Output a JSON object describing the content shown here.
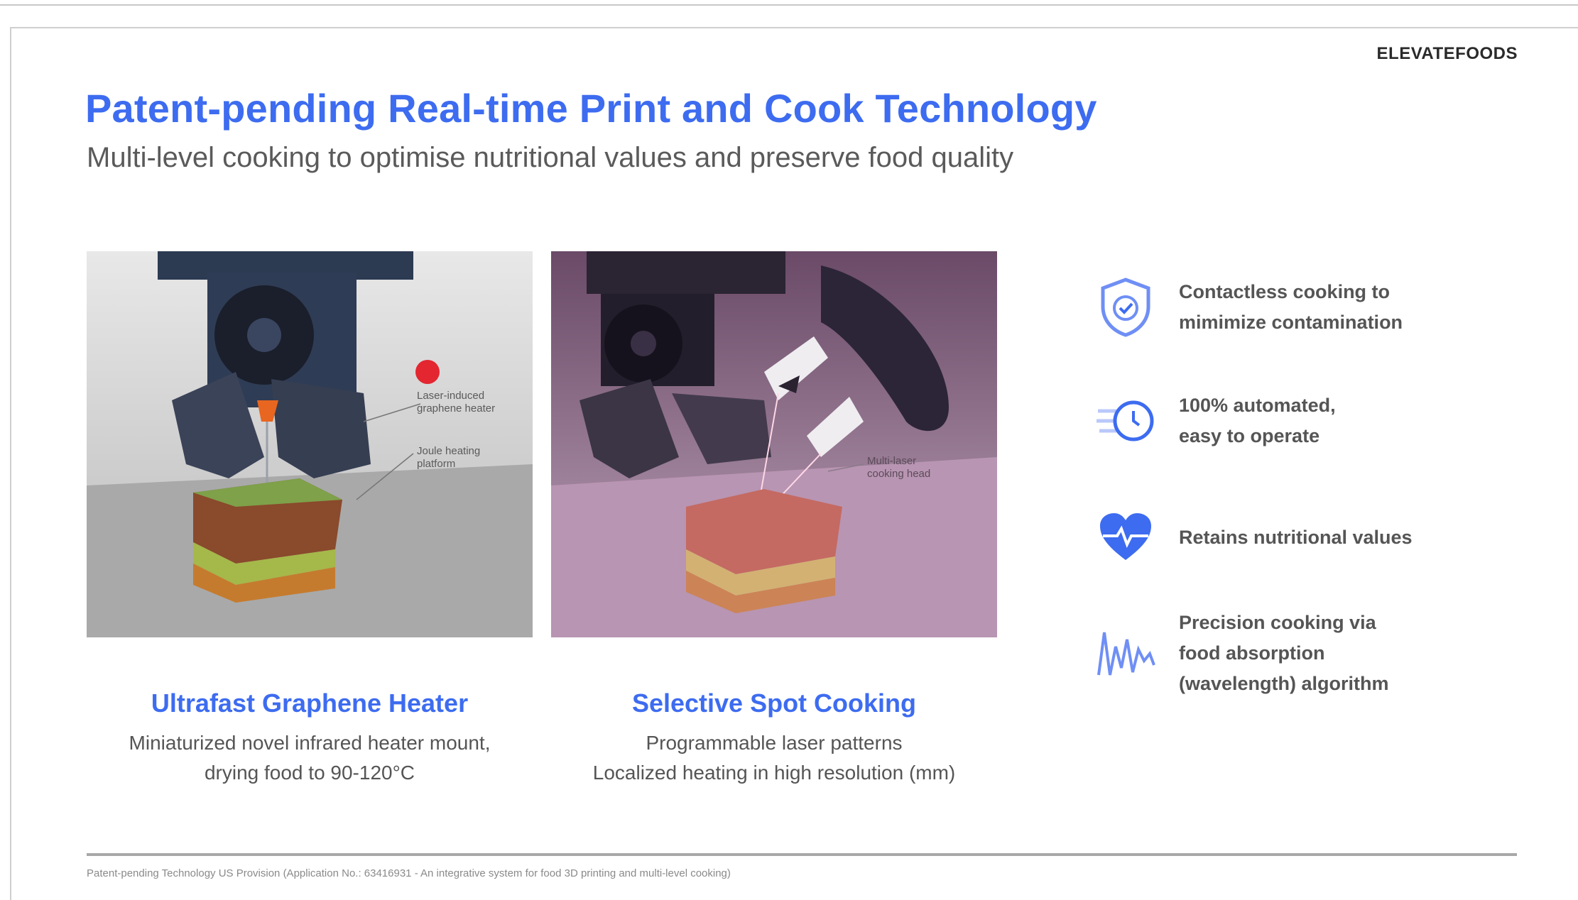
{
  "brand": "ELEVATEFOODS",
  "title": "Patent-pending Real-time Print and Cook Technology",
  "subtitle": "Multi-level cooking to optimise nutritional values and preserve food quality",
  "panels": [
    {
      "labels": [
        "Laser-induced",
        "graphene heater",
        "Joule heating",
        "platform"
      ],
      "caption_title": "Ultrafast Graphene Heater",
      "caption_lines": [
        "Miniaturized novel infrared heater mount,",
        "drying food to 90-120°C"
      ]
    },
    {
      "labels": [
        "Multi-laser",
        "cooking head"
      ],
      "caption_title": "Selective Spot Cooking",
      "caption_lines": [
        "Programmable laser patterns",
        "Localized heating in high resolution (mm)"
      ]
    }
  ],
  "features": [
    {
      "icon": "shield-check-icon",
      "lines": [
        "Contactless cooking to",
        "mimimize contamination"
      ]
    },
    {
      "icon": "fast-clock-icon",
      "lines": [
        "100% automated,",
        "easy to operate"
      ]
    },
    {
      "icon": "heart-pulse-icon",
      "lines": [
        "Retains nutritional values"
      ]
    },
    {
      "icon": "waveform-icon",
      "lines": [
        "Precision cooking via",
        "food absorption",
        "(wavelength) algorithm"
      ]
    }
  ],
  "footer": "Patent-pending Technology US Provision (Application No.: 63416931 - An integrative system for food 3D printing and multi-level cooking)",
  "colors": {
    "accent": "#3d6cf0",
    "text": "#555555"
  }
}
